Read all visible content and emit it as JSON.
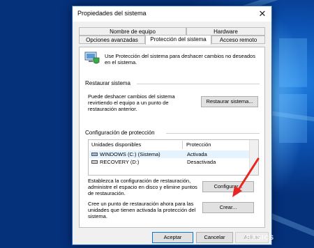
{
  "window": {
    "title": "Propiedades del sistema",
    "close_glyph": "✕"
  },
  "tabs": {
    "row1": [
      "Nombre de equipo",
      "Hardware"
    ],
    "row2": [
      "Opciones avanzadas",
      "Protección del sistema",
      "Acceso remoto"
    ],
    "active": "Protección del sistema"
  },
  "intro": {
    "text_line1": "Use Protección del sistema para deshacer cambios no deseados",
    "text_line2": "en el sistema."
  },
  "restore": {
    "heading": "Restaurar sistema",
    "text_line1": "Puede deshacer cambios del sistema",
    "text_line2": "revirtiendo el equipo a un punto de",
    "text_line3": "restauración anterior.",
    "button": "Restaurar sistema..."
  },
  "protection": {
    "heading": "Configuración de protección",
    "columns": [
      "Unidades disponibles",
      "Protección"
    ],
    "drives": [
      {
        "name": "WINDOWS (C:) (Sistema)",
        "status": "Activada"
      },
      {
        "name": "RECOVERY (D:)",
        "status": "Desactivada"
      }
    ],
    "config_text_line1": "Establezca la configuración de restauración,",
    "config_text_line2": "administre el espacio en disco y elimine puntos",
    "config_text_line3": "de restauración.",
    "config_button": "Configurar...",
    "create_text_line1": "Cree un punto de restauración ahora para las",
    "create_text_line2": "unidades que tienen activada la protección del",
    "create_text_line3": "sistema.",
    "create_button": "Crear..."
  },
  "footer": {
    "ok": "Aceptar",
    "cancel": "Cancelar",
    "apply": "Aplicar"
  },
  "watermark": "BASICS",
  "colors": {
    "accent": "#0078d7",
    "annotation_arrow": "#e8251f",
    "desktop": "#0a4fa6"
  }
}
